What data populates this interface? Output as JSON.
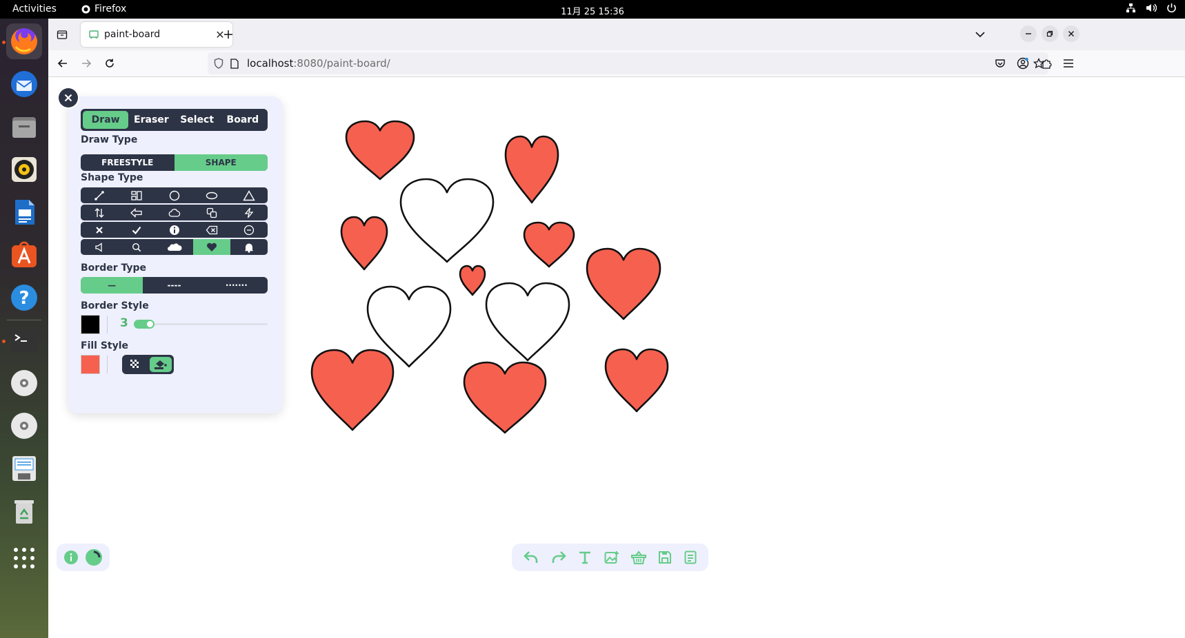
{
  "system": {
    "activities": "Activities",
    "app_name": "Firefox",
    "clock": "11月 25  15:36"
  },
  "dock": {
    "items": [
      "firefox-icon",
      "thunderbird-icon",
      "files-icon",
      "rhythmbox-icon",
      "writer-icon",
      "app-center-icon",
      "help-icon",
      "terminal-icon",
      "disc-icon",
      "disc-icon-2",
      "floppy-icon",
      "trash-icon",
      "app-grid-icon"
    ]
  },
  "browser": {
    "tab_title": "paint-board",
    "url_host": "localhost",
    "url_rest": ":8080/paint-board/"
  },
  "panel": {
    "mode_tabs": [
      {
        "label": "Draw",
        "active": true
      },
      {
        "label": "Eraser",
        "active": false
      },
      {
        "label": "Select",
        "active": false
      },
      {
        "label": "Board",
        "active": false
      }
    ],
    "draw_type_label": "Draw Type",
    "draw_types": [
      {
        "label": "FREESTYLE",
        "active": false
      },
      {
        "label": "SHAPE",
        "active": true
      }
    ],
    "shape_type_label": "Shape Type",
    "shape_rows": [
      [
        "line-icon",
        "layout-icon",
        "circle-icon",
        "ellipse-icon",
        "triangle-icon"
      ],
      [
        "arrows-updown-icon",
        "arrow-left-icon",
        "cloud-icon",
        "copy-icon",
        "lightning-icon"
      ],
      [
        "cross-icon",
        "check-icon",
        "info-icon",
        "backspace-icon",
        "minus-circle-icon"
      ],
      [
        "speaker-icon",
        "magnifier-icon",
        "cloud-solid-icon",
        "heart-icon",
        "bell-icon"
      ]
    ],
    "selected_shape": "heart-icon",
    "border_type_label": "Border Type",
    "border_types": [
      {
        "label": "—",
        "active": true
      },
      {
        "label": "----",
        "active": false
      },
      {
        "label": "·······",
        "active": false
      }
    ],
    "border_style_label": "Border Style",
    "border_color": "#000000",
    "border_width": "3",
    "border_width_fraction": 0.12,
    "fill_style_label": "Fill Style",
    "fill_color": "#f6604f",
    "fill_modes": [
      {
        "icon": "transparent-icon",
        "active": false
      },
      {
        "icon": "fill-bucket-icon",
        "active": true
      }
    ]
  },
  "canvas": {
    "shape": "heart",
    "stroke": "#111111",
    "fill_red": "#f6604f",
    "fill_white": "#ffffff"
  },
  "bottom_left": [
    "info-icon",
    "color-wheel-icon"
  ],
  "bottom_toolbar": [
    "undo-icon",
    "redo-icon",
    "text-icon",
    "image-add-icon",
    "basket-icon",
    "save-icon",
    "notes-icon"
  ],
  "colors": {
    "accent": "#66cc8a",
    "panel_bg": "#eef0fd",
    "dark": "#2d3446"
  }
}
